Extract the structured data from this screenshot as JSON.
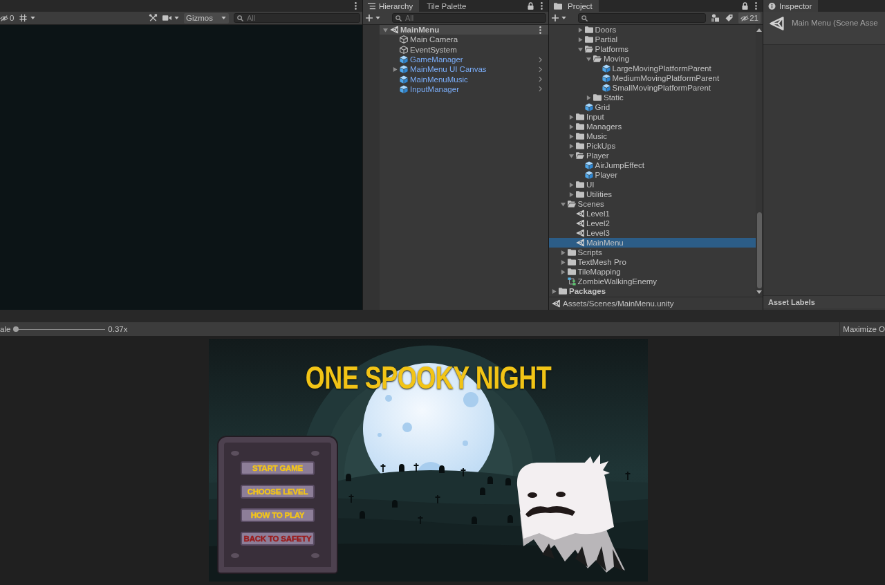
{
  "scene_view": {
    "toolbar": {
      "hidden_count": "0",
      "gizmos": "Gizmos",
      "search_placeholder": "All"
    }
  },
  "hierarchy": {
    "tabs": [
      {
        "label": "Hierarchy",
        "kind": "hierarchy",
        "selected": true
      },
      {
        "label": "Tile Palette",
        "kind": "tile-palette",
        "selected": false
      }
    ],
    "search_placeholder": "All",
    "scene": {
      "label": "MainMenu",
      "expanded": true,
      "selected": false,
      "children": [
        {
          "label": "Main Camera",
          "kind": "gameobject",
          "selected": false
        },
        {
          "label": "EventSystem",
          "kind": "gameobject",
          "selected": false
        },
        {
          "label": "GameManager",
          "kind": "prefab",
          "selected": false
        },
        {
          "label": "MainMenu UI Canvas",
          "kind": "prefab",
          "expanded": false,
          "selected": false
        },
        {
          "label": "MainMenuMusic",
          "kind": "prefab",
          "selected": false
        },
        {
          "label": "InputManager",
          "kind": "prefab",
          "selected": false
        }
      ]
    }
  },
  "project": {
    "tab": "Project",
    "hidden_packages": "21",
    "tree": [
      {
        "children": [
          {
            "children": [
              {
                "children": [
                  {
                    "label": "Doors",
                    "kind": "folder",
                    "expanded": false,
                    "selected": false
                  },
                  {
                    "label": "Partial",
                    "kind": "folder",
                    "expanded": false,
                    "selected": false
                  },
                  {
                    "label": "Platforms",
                    "kind": "folder",
                    "expanded": true,
                    "selected": false,
                    "children": [
                      {
                        "label": "Moving",
                        "kind": "folder",
                        "expanded": true,
                        "selected": false,
                        "children": [
                          {
                            "label": "LargeMovingPlatformParent",
                            "kind": "prefab",
                            "selected": false
                          },
                          {
                            "label": "MediumMovingPlatformParent",
                            "kind": "prefab",
                            "selected": false
                          },
                          {
                            "label": "SmallMovingPlatformParent",
                            "kind": "prefab",
                            "selected": false
                          }
                        ]
                      },
                      {
                        "label": "Static",
                        "kind": "folder",
                        "expanded": false,
                        "selected": false
                      }
                    ]
                  },
                  {
                    "label": "Grid",
                    "kind": "prefab",
                    "selected": false
                  }
                ]
              },
              {
                "label": "Input",
                "kind": "folder",
                "expanded": false,
                "selected": false
              },
              {
                "label": "Managers",
                "kind": "folder",
                "expanded": false,
                "selected": false
              },
              {
                "label": "Music",
                "kind": "folder",
                "expanded": false,
                "selected": false
              },
              {
                "label": "PickUps",
                "kind": "folder",
                "expanded": false,
                "selected": false
              },
              {
                "label": "Player",
                "kind": "folder",
                "expanded": true,
                "selected": false,
                "children": [
                  {
                    "label": "AirJumpEffect",
                    "kind": "prefab",
                    "selected": false
                  },
                  {
                    "label": "Player",
                    "kind": "prefab",
                    "selected": false
                  }
                ]
              },
              {
                "label": "UI",
                "kind": "folder",
                "expanded": false,
                "selected": false
              },
              {
                "label": "Utilities",
                "kind": "folder",
                "expanded": false,
                "selected": false
              }
            ]
          },
          {
            "label": "Scenes",
            "kind": "folder",
            "expanded": true,
            "selected": false,
            "children": [
              {
                "label": "Level1",
                "kind": "scene",
                "selected": false
              },
              {
                "label": "Level2",
                "kind": "scene",
                "selected": false
              },
              {
                "label": "Level3",
                "kind": "scene",
                "selected": false
              },
              {
                "label": "MainMenu",
                "kind": "scene",
                "selected": true
              }
            ]
          },
          {
            "label": "Scripts",
            "kind": "folder",
            "expanded": false,
            "selected": false
          },
          {
            "label": "TextMesh Pro",
            "kind": "folder",
            "expanded": false,
            "selected": false
          },
          {
            "label": "TileMapping",
            "kind": "folder",
            "expanded": false,
            "selected": false
          },
          {
            "label": "ZombieWalkingEnemy",
            "kind": "animator",
            "selected": false
          }
        ]
      },
      {
        "label": "Packages",
        "kind": "root-folder",
        "expanded": false,
        "selected": false
      }
    ],
    "path": "Assets/Scenes/MainMenu.unity"
  },
  "inspector": {
    "tab": "Inspector",
    "title": "Main Menu (Scene Asse",
    "footer": "Asset Labels"
  },
  "game_view": {
    "toolbar": {
      "scale_label": "ale",
      "scale": {
        "level": 0
      },
      "scale_reading": "0.37x",
      "maximize": "Maximize O"
    },
    "game": {
      "title": "ONE SPOOKY NIGHT",
      "menu_buttons": [
        {
          "label": "START GAME",
          "kind": "normal"
        },
        {
          "label": "CHOOSE LEVEL",
          "kind": "normal"
        },
        {
          "label": "HOW TO PLAY",
          "kind": "normal"
        },
        {
          "label": "BACK TO SAFETY",
          "kind": "danger"
        }
      ]
    }
  }
}
